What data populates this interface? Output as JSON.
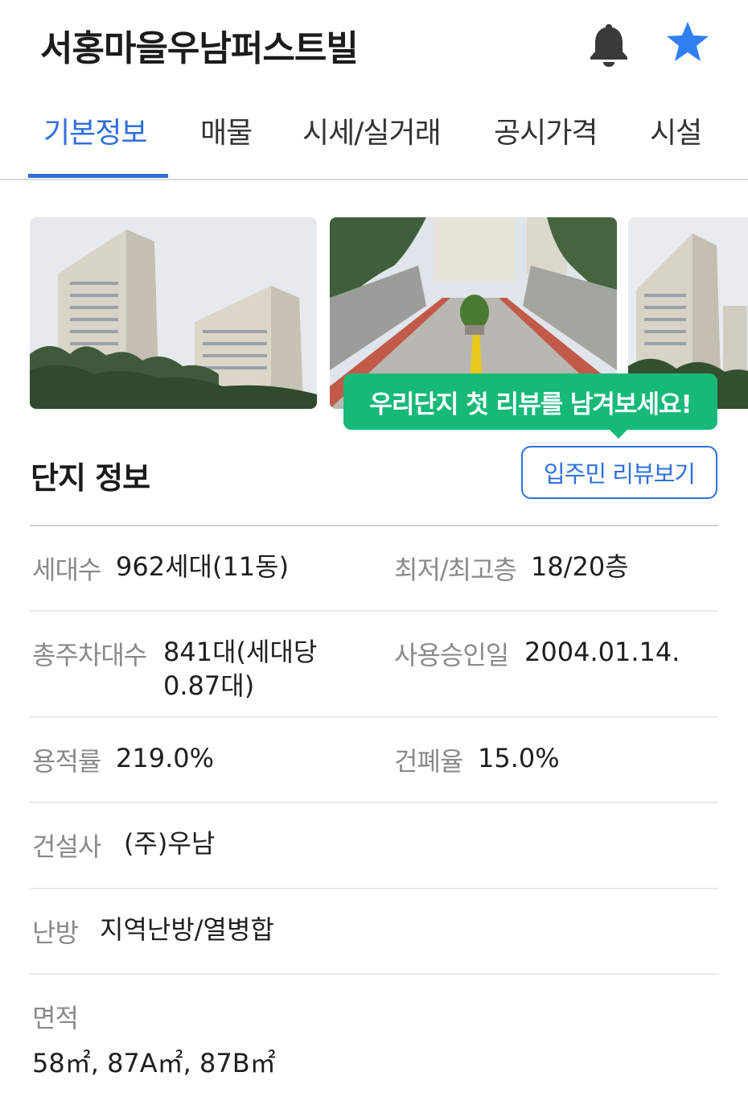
{
  "header": {
    "title": "서홍마을우남퍼스트빌",
    "icons": [
      "bell-icon",
      "star-icon"
    ],
    "accent_color": "#2f6fdc"
  },
  "tabs": [
    {
      "label": "기본정보",
      "active": true
    },
    {
      "label": "매물",
      "active": false
    },
    {
      "label": "시세/실거래",
      "active": false
    },
    {
      "label": "공시가격",
      "active": false
    },
    {
      "label": "시설",
      "active": false
    }
  ],
  "photos": [
    "apartment-buildings-photo",
    "entrance-road-photo",
    "apartment-building-photo"
  ],
  "tooltip": {
    "text": "우리단지 첫 리뷰를 남겨보세요!",
    "color": "#17b978"
  },
  "complex": {
    "section_title": "단지 정보",
    "review_button": "입주민 리뷰보기",
    "households": {
      "label": "세대수",
      "value": "962세대(11동)"
    },
    "floors": {
      "label": "최저/최고층",
      "value": "18/20층"
    },
    "parking": {
      "label": "총주차대수",
      "value_line1": "841대(세대당",
      "value_line2": "0.87대)"
    },
    "approval": {
      "label": "사용승인일",
      "value": "2004.01.14."
    },
    "far": {
      "label": "용적률",
      "value": "219.0%"
    },
    "bcr": {
      "label": "건폐율",
      "value": "15.0%"
    },
    "builder": {
      "label": "건설사",
      "value": "(주)우남"
    },
    "heating": {
      "label": "난방",
      "value": "지역난방/열병합"
    },
    "area": {
      "label": "면적",
      "value": "58㎡, 87A㎡, 87B㎡"
    }
  }
}
